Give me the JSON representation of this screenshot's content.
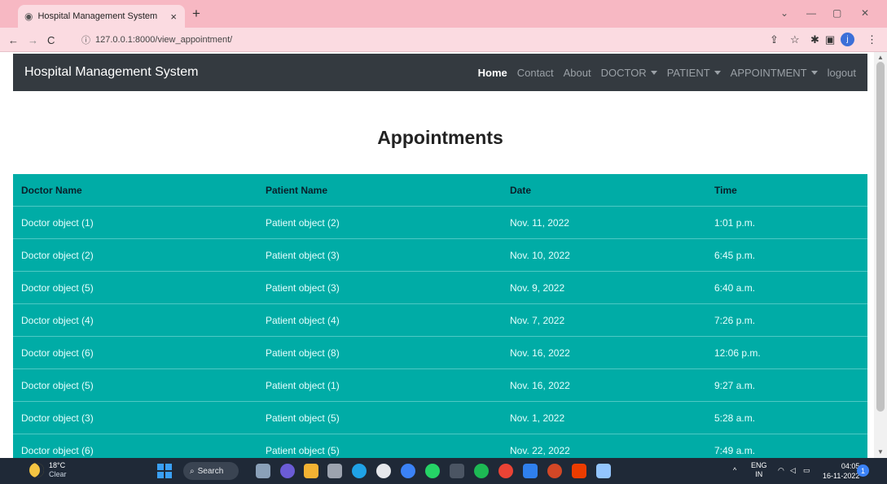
{
  "browser": {
    "tab_title": "Hospital Management System",
    "tab_close": "×",
    "new_tab": "+",
    "url": "127.0.0.1:8000/view_appointment/",
    "profile_initial": "j",
    "window_minimize": "—",
    "window_restore": "▢",
    "window_close": "✕",
    "window_dropdown": "⌄"
  },
  "navbar": {
    "brand": "Hospital Management System",
    "links": {
      "home": "Home",
      "contact": "Contact",
      "about": "About",
      "doctor": "DOCTOR",
      "patient": "PATIENT",
      "appointment": "APPOINTMENT",
      "logout": "logout"
    }
  },
  "page": {
    "title": "Appointments"
  },
  "table": {
    "headers": [
      "Doctor Name",
      "Patient Name",
      "Date",
      "Time"
    ],
    "rows": [
      [
        "Doctor object (1)",
        "Patient object (2)",
        "Nov. 11, 2022",
        "1:01 p.m."
      ],
      [
        "Doctor object (2)",
        "Patient object (3)",
        "Nov. 10, 2022",
        "6:45 p.m."
      ],
      [
        "Doctor object (5)",
        "Patient object (3)",
        "Nov. 9, 2022",
        "6:40 a.m."
      ],
      [
        "Doctor object (4)",
        "Patient object (4)",
        "Nov. 7, 2022",
        "7:26 p.m."
      ],
      [
        "Doctor object (6)",
        "Patient object (8)",
        "Nov. 16, 2022",
        "12:06 p.m."
      ],
      [
        "Doctor object (5)",
        "Patient object (1)",
        "Nov. 16, 2022",
        "9:27 a.m."
      ],
      [
        "Doctor object (3)",
        "Patient object (5)",
        "Nov. 1, 2022",
        "5:28 a.m."
      ],
      [
        "Doctor object (6)",
        "Patient object (5)",
        "Nov. 22, 2022",
        "7:49 a.m."
      ]
    ]
  },
  "taskbar": {
    "temperature": "18°C",
    "weather": "Clear",
    "search_label": "Search",
    "language": "ENG",
    "region": "IN",
    "time": "04:05",
    "date": "16-11-2022",
    "notifications": "1"
  },
  "colors": {
    "tabbar": "#f7b8c3",
    "navbar": "#343a40",
    "table_row": "#00aca6"
  }
}
